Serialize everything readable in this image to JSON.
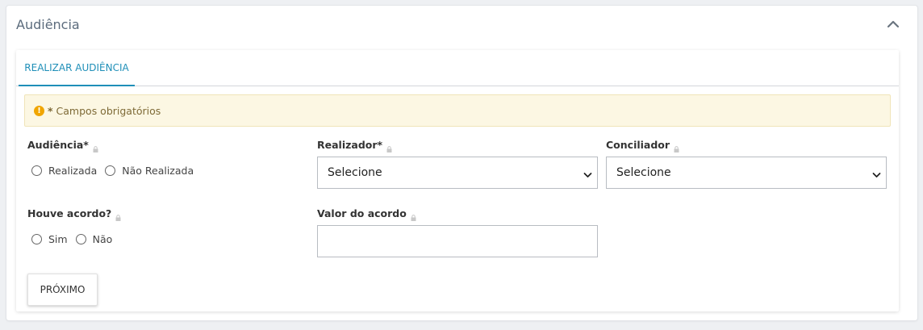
{
  "panel": {
    "title": "Audiência"
  },
  "tabs": [
    {
      "label": "REALIZAR AUDIÊNCIA",
      "active": true
    }
  ],
  "alert": {
    "icon": "exclamation-circle-icon",
    "marker": "*",
    "text": "Campos obrigatórios",
    "color": "#f0a500"
  },
  "form": {
    "audiencia": {
      "label": "Audiência*",
      "options": [
        "Realizada",
        "Não Realizada"
      ]
    },
    "realizador": {
      "label": "Realizador*",
      "value": "Selecione"
    },
    "conciliador": {
      "label": "Conciliador",
      "value": "Selecione"
    },
    "houve_acordo": {
      "label": "Houve acordo?",
      "options": [
        "Sim",
        "Não"
      ]
    },
    "valor_acordo": {
      "label": "Valor do acordo",
      "value": ""
    }
  },
  "actions": {
    "next_label": "PRÓXIMO"
  },
  "colors": {
    "accent": "#1f8fb8",
    "alert_bg": "#fcf7e3",
    "alert_text": "#7e6a36"
  }
}
